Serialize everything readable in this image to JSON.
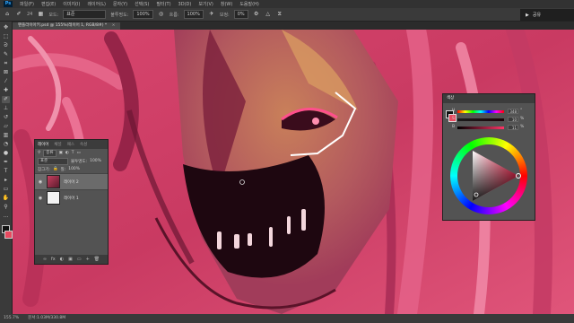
{
  "menu": {
    "logo": "Ps",
    "items": [
      "파일(F)",
      "편집(E)",
      "이미지(I)",
      "레이어(L)",
      "문자(Y)",
      "선택(S)",
      "필터(T)",
      "3D(D)",
      "보기(V)",
      "창(W)",
      "도움말(H)"
    ]
  },
  "options": {
    "brush_size": "24",
    "mode_label": "모드:",
    "mode_value": "표준",
    "opacity_label": "불투명도:",
    "opacity_value": "100%",
    "flow_label": "흐름:",
    "flow_value": "100%",
    "smoothing_label": "보정:",
    "smoothing_value": "0%",
    "share_label": "공유"
  },
  "document": {
    "tab_title": "팬플라이아키.psd @ 155%(레이어 1, RGB/8#) *",
    "close": "×"
  },
  "tools": [
    {
      "name": "move-tool-icon",
      "glyph": "✥"
    },
    {
      "name": "marquee-tool-icon",
      "glyph": "⬚"
    },
    {
      "name": "lasso-tool-icon",
      "glyph": "ᘐ"
    },
    {
      "name": "quick-select-icon",
      "glyph": "✎"
    },
    {
      "name": "crop-tool-icon",
      "glyph": "⌗"
    },
    {
      "name": "frame-tool-icon",
      "glyph": "⊠"
    },
    {
      "name": "eyedropper-icon",
      "glyph": "⁄"
    },
    {
      "name": "healing-brush-icon",
      "glyph": "✚"
    },
    {
      "name": "brush-tool-icon",
      "glyph": "✐",
      "active": true
    },
    {
      "name": "clone-stamp-icon",
      "glyph": "⊥"
    },
    {
      "name": "history-brush-icon",
      "glyph": "↺"
    },
    {
      "name": "eraser-icon",
      "glyph": "▱"
    },
    {
      "name": "gradient-icon",
      "glyph": "▥"
    },
    {
      "name": "blur-icon",
      "glyph": "◔"
    },
    {
      "name": "dodge-icon",
      "glyph": "●"
    },
    {
      "name": "pen-tool-icon",
      "glyph": "✒"
    },
    {
      "name": "type-tool-icon",
      "glyph": "T"
    },
    {
      "name": "path-select-icon",
      "glyph": "▸"
    },
    {
      "name": "shape-tool-icon",
      "glyph": "▭"
    },
    {
      "name": "hand-tool-icon",
      "glyph": "✋"
    },
    {
      "name": "zoom-tool-icon",
      "glyph": "⚲"
    },
    {
      "name": "more-tools-icon",
      "glyph": "…"
    }
  ],
  "colors": {
    "foreground": "#111111",
    "background": "#e84a5f"
  },
  "layers_panel": {
    "tabs": [
      "레이어",
      "채널",
      "패스",
      "속성"
    ],
    "kind_label": "종류",
    "blend_mode": "표준",
    "opacity_label": "불투명도:",
    "opacity_value": "100%",
    "lock_label": "잠그기:",
    "fill_label": "칠:",
    "fill_value": "100%",
    "layers": [
      {
        "name": "레이어 2",
        "selected": true
      },
      {
        "name": "레이어 1",
        "selected": false
      }
    ],
    "bottom_icons": [
      "∞",
      "fx",
      "◐",
      "▣",
      "▭",
      "+",
      "🗑"
    ]
  },
  "color_panel": {
    "title": "색상",
    "channels": [
      {
        "label": "H",
        "value": "348",
        "unit": "°"
      },
      {
        "label": "S",
        "value": "10",
        "unit": "%"
      },
      {
        "label": "B",
        "value": "11",
        "unit": "%"
      }
    ]
  },
  "status": {
    "zoom": "155.7%",
    "doc_size": "문서:1.03M/330.8M"
  }
}
